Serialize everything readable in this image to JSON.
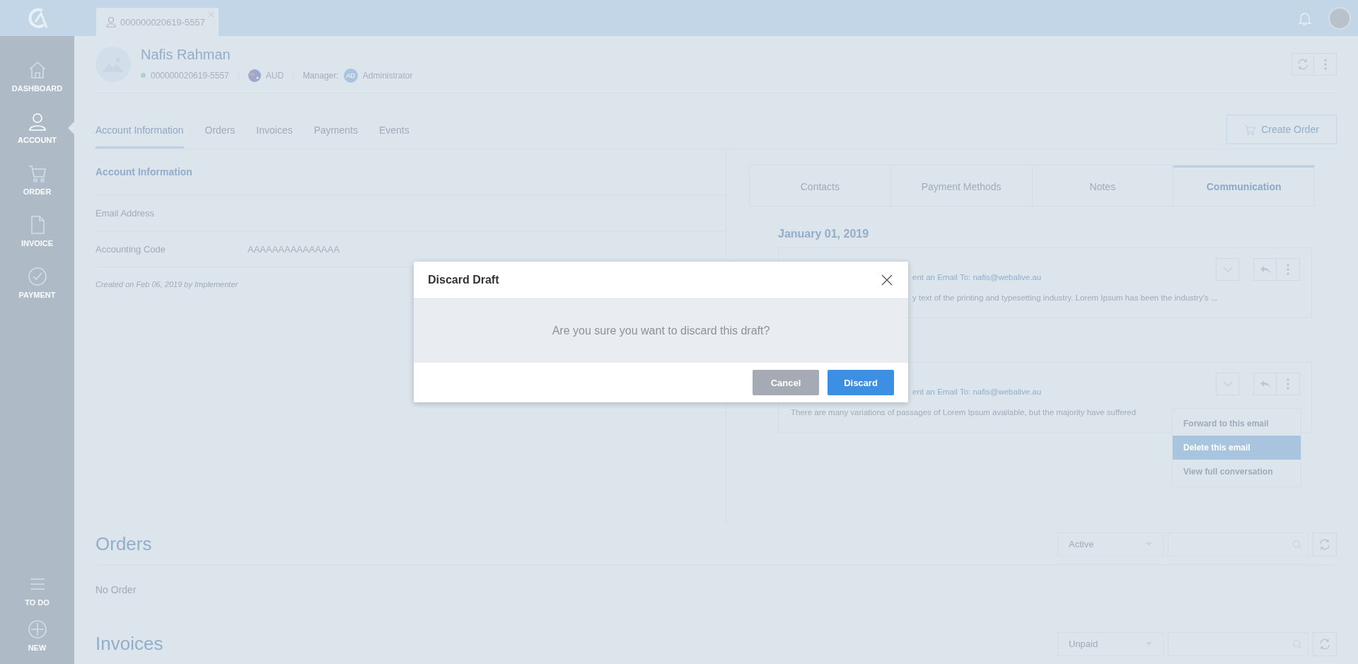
{
  "top_bar": {
    "tab": {
      "label": "000000020619-5557"
    }
  },
  "sidebar": {
    "items": [
      {
        "label": "DASHBOARD",
        "kind": "home",
        "selected": false
      },
      {
        "label": "ACCOUNT",
        "kind": "person",
        "selected": true
      },
      {
        "label": "ORDER",
        "kind": "cart",
        "selected": false
      },
      {
        "label": "INVOICE",
        "kind": "document",
        "selected": false
      },
      {
        "label": "PAYMENT",
        "kind": "check",
        "selected": false
      }
    ],
    "bottom_items": [
      {
        "label": "TO DO",
        "kind": "list"
      },
      {
        "label": "NEW",
        "kind": "plus"
      }
    ]
  },
  "account": {
    "name": "Nafis Rahman",
    "number": "000000020619-5557",
    "currency": "AUD",
    "manager_label": "Manager:",
    "manager_initials": "AD",
    "manager": "Administrator"
  },
  "tabs": [
    {
      "label": "Account Information",
      "selected": true
    },
    {
      "label": "Orders",
      "selected": false
    },
    {
      "label": "Invoices",
      "selected": false
    },
    {
      "label": "Payments",
      "selected": false
    },
    {
      "label": "Events",
      "selected": false
    }
  ],
  "create_order": "Create Order",
  "account_info": {
    "title": "Account Information",
    "fields": [
      {
        "label": "Email Address"
      },
      {
        "label": "Accounting Code",
        "value": "AAAAAAAAAAAAAAA"
      }
    ],
    "created": "Created on Feb 06, 2019 by Implementer"
  },
  "side_tabs": [
    {
      "label": "Contacts",
      "selected": false
    },
    {
      "label": "Payment Methods",
      "selected": false
    },
    {
      "label": "Notes",
      "selected": false
    },
    {
      "label": "Communication",
      "selected": true
    }
  ],
  "communication": {
    "date": "January 01, 2019",
    "emails": [
      {
        "recipient": "ent an Email To: nafis@webalive.au",
        "preview": "y text of the printing and typesetting industry. Lorem Ipsum has been the industry's ..."
      },
      {
        "recipient": "ent an Email To: nafis@webalive.au",
        "preview": "There are many variations of passages of Lorem Ipsum available, but the majority have suffered"
      }
    ],
    "menu": [
      {
        "label": "Forward to this email",
        "selected": false
      },
      {
        "label": "Delete this email",
        "selected": true
      },
      {
        "label": "View full conversation",
        "selected": false
      }
    ]
  },
  "orders": {
    "title": "Orders",
    "filter": "Active",
    "empty": "No Order"
  },
  "invoices": {
    "title": "Invoices",
    "filter": "Unpaid"
  },
  "dialog": {
    "title": "Discard Draft",
    "message": "Are you sure you want to discard this draft?",
    "buttons": [
      {
        "label": "Cancel",
        "kind": "secondary"
      },
      {
        "label": "Discard",
        "kind": "primary"
      }
    ]
  }
}
